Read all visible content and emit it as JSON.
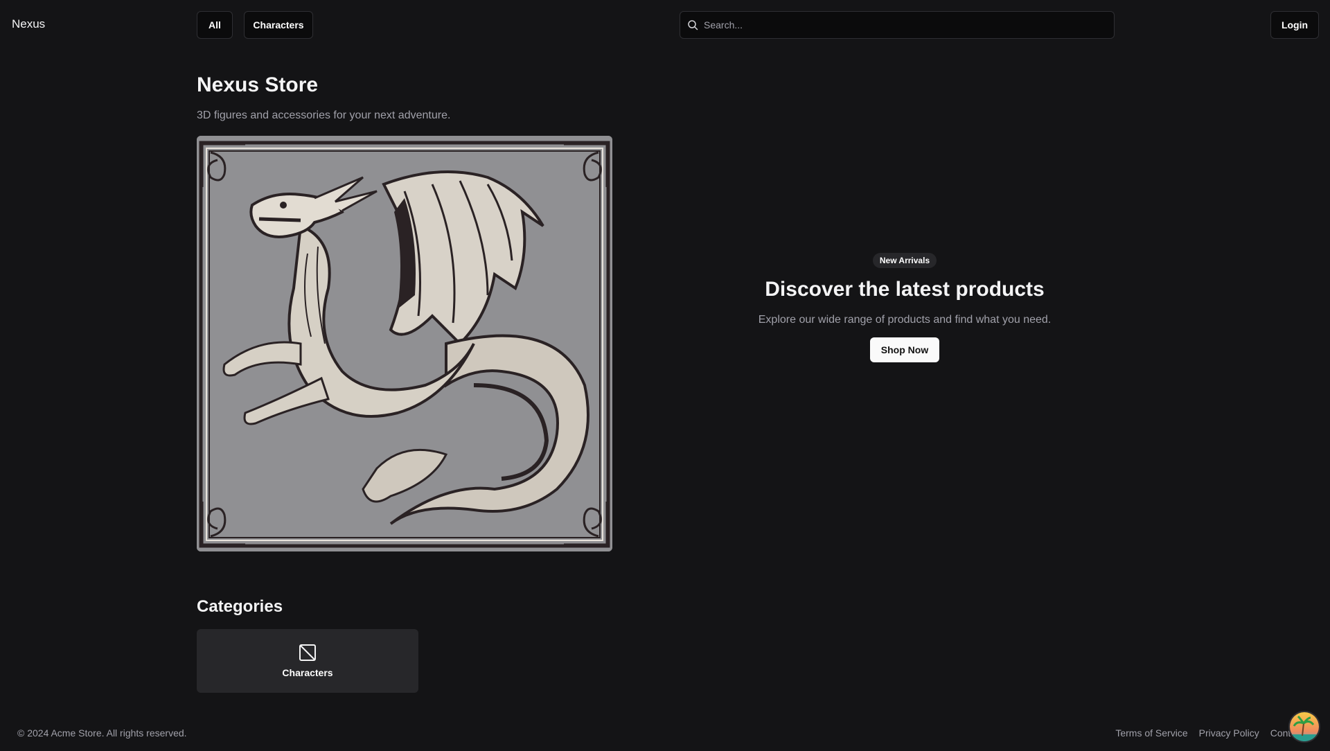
{
  "header": {
    "brand": "Nexus",
    "nav": [
      {
        "label": "All"
      },
      {
        "label": "Characters"
      }
    ],
    "search_placeholder": "Search...",
    "login_label": "Login"
  },
  "store": {
    "title": "Nexus Store",
    "subtitle": "3D figures and accessories for your next adventure."
  },
  "hero_image": {
    "description_icon": "dragon-illustration"
  },
  "promo": {
    "badge": "New Arrivals",
    "title": "Discover the latest products",
    "subtitle": "Explore our wide range of products and find what you need.",
    "button": "Shop Now"
  },
  "categories": {
    "title": "Categories",
    "items": [
      {
        "label": "Characters",
        "icon": "image-placeholder-icon"
      }
    ]
  },
  "footer": {
    "copyright": "© 2024 Acme Store. All rights reserved.",
    "links": [
      "Terms of Service",
      "Privacy Policy",
      "Contact"
    ]
  },
  "colors": {
    "background": "#141416",
    "card": "#27272a",
    "muted_text": "#a1a1aa",
    "button_light": "#fafafa"
  }
}
